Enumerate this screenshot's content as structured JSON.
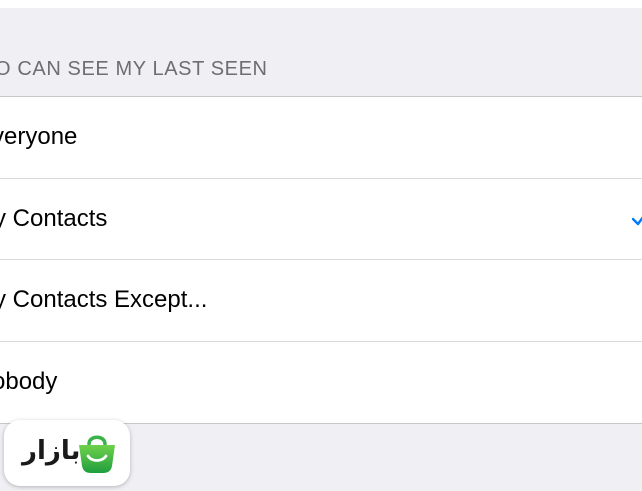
{
  "section": {
    "header": "HO CAN SEE MY LAST SEEN"
  },
  "options": [
    {
      "label": "veryone",
      "selected": false
    },
    {
      "label": "y Contacts",
      "selected": true
    },
    {
      "label": "y Contacts Except...",
      "selected": false
    },
    {
      "label": "obody",
      "selected": false
    }
  ],
  "badge": {
    "text": "بازار",
    "icon": "shopping-bag-icon"
  },
  "colors": {
    "background": "#efeff4",
    "header_text": "#6d6d72",
    "check": "#007aff",
    "badge_green": "#3bb34a"
  }
}
